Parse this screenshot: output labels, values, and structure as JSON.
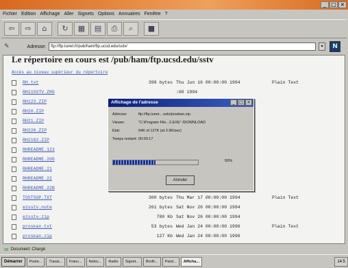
{
  "window": {
    "title": ""
  },
  "menu": [
    "Fichier",
    "Edition",
    "Affichage",
    "Aller",
    "Signets",
    "Options",
    "Annuaires",
    "Fenêtre",
    "?"
  ],
  "toolbar": {
    "buttons": [
      "back",
      "forward",
      "home",
      "reload",
      "images",
      "open",
      "print",
      "find",
      "stop"
    ]
  },
  "address": {
    "label": "Adresse:",
    "value": "ftp://ftp.lunet.fr/pub/ham/ftp.ucsd.edu/sstv/"
  },
  "page": {
    "heading": "Le répertoire en cours est /pub/ham/ftp.ucsd.edu/sstv",
    "parent_link": "Accès au niveau supérieur du répertoire"
  },
  "files": [
    {
      "name": "RH.txt",
      "size": "398 bytes",
      "date": "Thu Jun 16 00:00:00 1994",
      "type": "Plain Text"
    },
    {
      "name": "RH11SSTV.ZRG",
      "size": "",
      "date": ":00 1994",
      "type": ""
    },
    {
      "name": "RH123.ZIP",
      "size": "",
      "date": ":00 1994",
      "type": ""
    },
    {
      "name": "RH20.ZIP",
      "size": "",
      "date": ":00 1994",
      "type": ""
    },
    {
      "name": "RH21.ZIP",
      "size": "",
      "date": ":00 1994",
      "type": ""
    },
    {
      "name": "RH220.ZIP",
      "size": "",
      "date": ":00 1995",
      "type": ""
    },
    {
      "name": "RH2182.ZIP",
      "size": "",
      "date": ":00 1995",
      "type": ""
    },
    {
      "name": "RHREADME.123",
      "size": "",
      "date": ":00 1994",
      "type": ""
    },
    {
      "name": "RHREADME.200",
      "size": "",
      "date": ":00 1994",
      "type": ""
    },
    {
      "name": "RHREADME.21",
      "size": "",
      "date": ":00 1994",
      "type": ""
    },
    {
      "name": "RHREADME.22",
      "size": "11 Kb",
      "date": "Fri Jun 02 00:00:00 1995",
      "type": ""
    },
    {
      "name": "RHREADME.22B",
      "size": "11 Kb",
      "date": "Wed May 24 00:00:00 1995",
      "type": ""
    },
    {
      "name": "TOSTSOP.TXT",
      "size": "300 bytes",
      "date": "Thu Mar 17 00:00:00 1994",
      "type": "Plain Text"
    },
    {
      "name": "ezsstv.note",
      "size": "261 bytes",
      "date": "Sat Nov 26 00:00:00 1994",
      "type": ""
    },
    {
      "name": "ezsstv.zip",
      "size": "780 Kb",
      "date": "Sat Nov 26 00:00:00 1994",
      "type": ""
    },
    {
      "name": "proskan.txt",
      "size": "53 bytes",
      "date": "Wed Jan 24 00:00:00 1996",
      "type": "Plain Text"
    },
    {
      "name": "proskan.zip",
      "size": "127 Kb",
      "date": "Wed Jan 24 00:00:00 1996",
      "type": ""
    }
  ],
  "dialog": {
    "title": "Affichage de l'adresse",
    "address_label": "Adresse:",
    "address_value": "ftp://ftp.lunet....sstv/proskan.zip",
    "viewer_label": "Viewer:",
    "viewer_value": "\"C:\\Program File...2.EXE\" /DOWNLOAD",
    "state_label": "Etat:",
    "state_value": "64K of 127K (at 3.9K/sec)",
    "time_label": "Temps restant:",
    "time_value": "00:00:17",
    "progress_percent": 50,
    "progress_label": "50%",
    "cancel_label": "Annuler"
  },
  "status": {
    "text": "Document: Chargé"
  },
  "taskbar": {
    "start_label": "Démarrer",
    "items": [
      "Poste...",
      "Travai...",
      "Franc...",
      "Netsc...",
      "Radio",
      "Signet...",
      "Broth...",
      "Paint...",
      "Afficha..."
    ],
    "active_index": 8,
    "clock": "14:5"
  }
}
